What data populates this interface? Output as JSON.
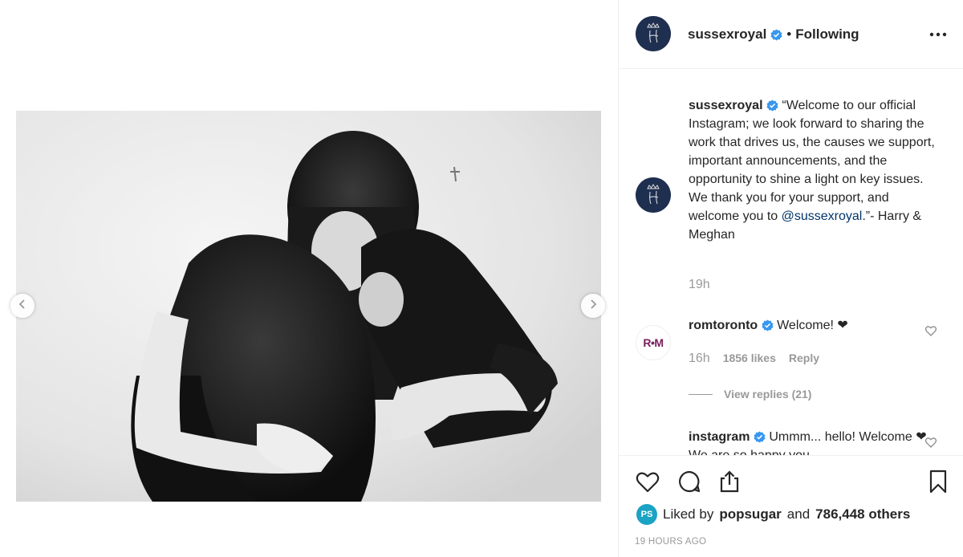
{
  "post": {
    "photo_alt": "Black and white photo of three women embracing"
  },
  "header": {
    "username": "sussexroyal",
    "dot": "•",
    "follow_status": "Following",
    "more_label": "•••"
  },
  "caption": {
    "username": "sussexroyal",
    "text_before": "“Welcome to our official Instagram; we look forward to sharing the work that drives us, the causes we support, important announcements, and the opportunity to shine a light on key issues. We thank you for your support, and welcome you to ",
    "mention": "@sussexroyal",
    "text_after": ".”- Harry & Meghan",
    "time": "19h"
  },
  "comments": [
    {
      "avatar_text": "R•M",
      "username": "romtoronto",
      "text": "Welcome! ❤",
      "time": "16h",
      "likes": "1856 likes",
      "reply": "Reply",
      "view_replies": "View replies (21)"
    },
    {
      "username": "instagram",
      "text": "Ummm... hello! Welcome ❤ We are so happy you"
    }
  ],
  "footer": {
    "liker_avatar": "PS",
    "liked_prefix": "Liked by",
    "liked_user": "popsugar",
    "liked_and": "and",
    "liked_others": "786,448 others",
    "timestamp": "19 HOURS AGO"
  },
  "colors": {
    "verified": "#3897f0",
    "avatar_bg": "#1f2f4f",
    "mention": "#003569",
    "muted": "#999999"
  }
}
